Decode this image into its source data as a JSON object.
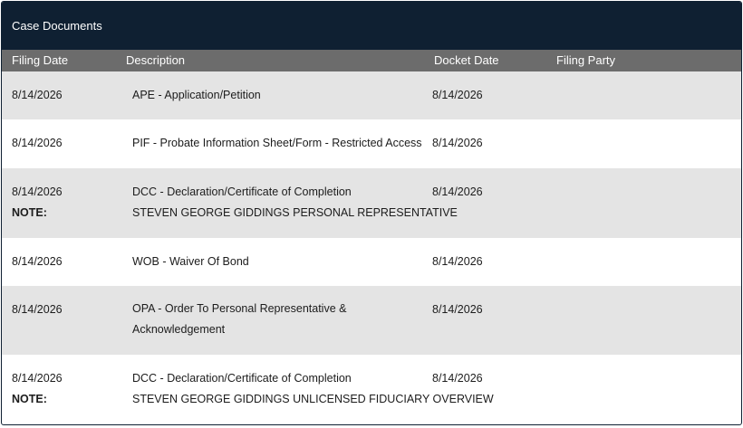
{
  "panel": {
    "title": "Case Documents"
  },
  "columns": {
    "filing_date": "Filing Date",
    "description": "Description",
    "docket_date": "Docket Date",
    "filing_party": "Filing Party"
  },
  "note_label": "NOTE:",
  "rows": [
    {
      "filing_date": "8/14/2026",
      "description": "APE - Application/Petition",
      "docket_date": "8/14/2026",
      "filing_party": "",
      "note": ""
    },
    {
      "filing_date": "8/14/2026",
      "description": "PIF - Probate Information Sheet/Form - Restricted Access",
      "docket_date": "8/14/2026",
      "filing_party": "",
      "note": ""
    },
    {
      "filing_date": "8/14/2026",
      "description": "DCC - Declaration/Certificate of Completion",
      "docket_date": "8/14/2026",
      "filing_party": "",
      "note": "STEVEN GEORGE GIDDINGS PERSONAL REPRESENTATIVE"
    },
    {
      "filing_date": "8/14/2026",
      "description": "WOB - Waiver Of Bond",
      "docket_date": "8/14/2026",
      "filing_party": "",
      "note": ""
    },
    {
      "filing_date": "8/14/2026",
      "description": "OPA - Order To Personal Representative & Acknowledgement",
      "docket_date": "8/14/2026",
      "filing_party": "",
      "note": ""
    },
    {
      "filing_date": "8/14/2026",
      "description": "DCC - Declaration/Certificate of Completion",
      "docket_date": "8/14/2026",
      "filing_party": "",
      "note": "STEVEN GEORGE GIDDINGS UNLICENSED FIDUCIARY OVERVIEW"
    }
  ]
}
